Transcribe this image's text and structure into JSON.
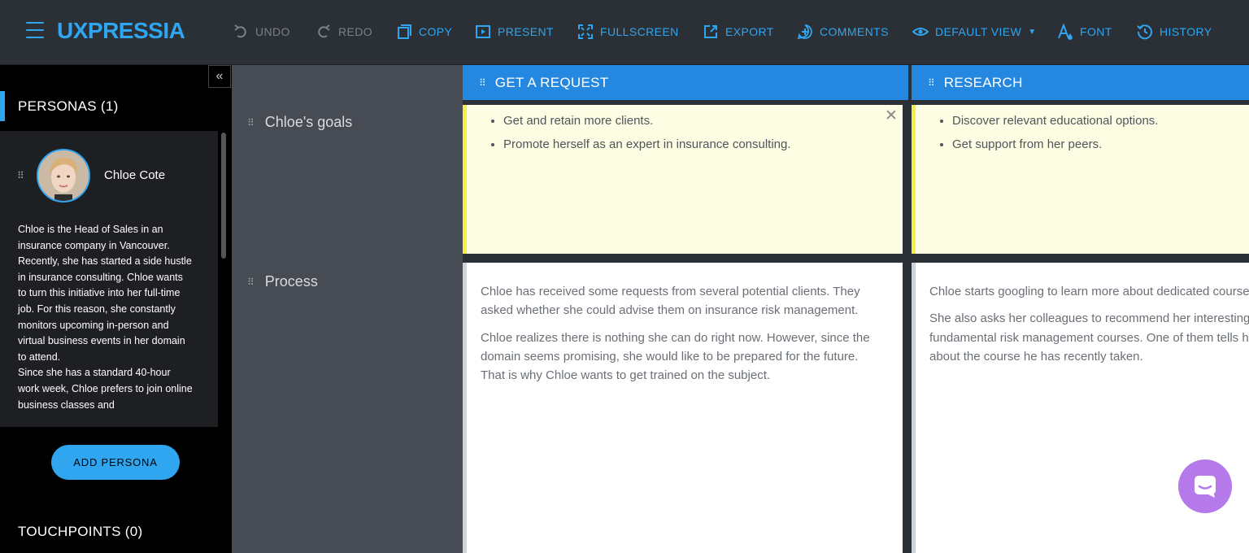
{
  "app": {
    "logo": "UXPRESSIA"
  },
  "toolbar": {
    "undo": "UNDO",
    "redo": "REDO",
    "copy": "COPY",
    "present": "PRESENT",
    "fullscreen": "FULLSCREEN",
    "export": "EXPORT",
    "comments": "COMMENTS",
    "default_view": "DEFAULT VIEW",
    "font": "FONT",
    "history": "HISTORY"
  },
  "sidebar": {
    "collapse_glyph": "«",
    "personas_title": "PERSONAS (1)",
    "persona": {
      "name": "Chloe Cote",
      "description": "Chloe is the Head of Sales in an insurance company in Vancouver. Recently, she has started a side hustle in insurance consulting. Chloe wants to turn this initiative into her full-time job. For this reason, she constantly monitors upcoming in-person and virtual business events in her domain to attend.\nSince she has a standard 40-hour work week, Chloe prefers to join online business classes and"
    },
    "add_persona": "ADD PERSONA",
    "touchpoints_title": "TOUCHPOINTS (0)"
  },
  "rows": {
    "goals": "Chloe's goals",
    "process": "Process"
  },
  "stages": [
    {
      "title": "GET A REQUEST",
      "goals": [
        "Get and retain more clients.",
        "Promote herself as an expert in insurance consulting."
      ],
      "process": [
        "Chloe has received some requests from several potential clients. They asked whether she could advise them on insurance risk management.",
        "Chloe realizes there is nothing she can do right now. However, since the domain seems promising, she would like to be prepared for the future. That is why Chloe wants to get trained on the subject."
      ]
    },
    {
      "title": "RESEARCH",
      "goals": [
        "Discover relevant educational options.",
        "Get support from her peers."
      ],
      "process": [
        "Chloe starts googling to learn more about dedicated courses.",
        "She also asks her colleagues to recommend her interesting fundamental risk management courses. One of them tells her about the course he has recently taken."
      ]
    }
  ],
  "colors": {
    "accent": "#2fa6ef",
    "stage_header": "#2488e0",
    "goal_cell": "#fdfde3",
    "goal_border": "#f4ee47",
    "chat_button": "#b579ea"
  }
}
